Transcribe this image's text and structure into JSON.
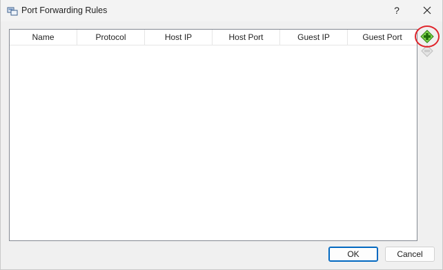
{
  "window": {
    "title": "Port Forwarding Rules",
    "help_label": "?",
    "icons": {
      "app": "virtualbox-network-icon",
      "close": "close-icon"
    }
  },
  "table": {
    "columns": [
      "Name",
      "Protocol",
      "Host IP",
      "Host Port",
      "Guest IP",
      "Guest Port"
    ],
    "rows": []
  },
  "side_actions": {
    "add": {
      "icon": "add-rule-icon",
      "highlighted": true,
      "enabled": true
    },
    "remove": {
      "icon": "remove-rule-icon",
      "enabled": false
    }
  },
  "buttons": {
    "ok": "OK",
    "cancel": "Cancel"
  },
  "colors": {
    "highlight": "#e0242b",
    "default_button_border": "#0067c0",
    "add_icon_green": "#3aa821"
  }
}
